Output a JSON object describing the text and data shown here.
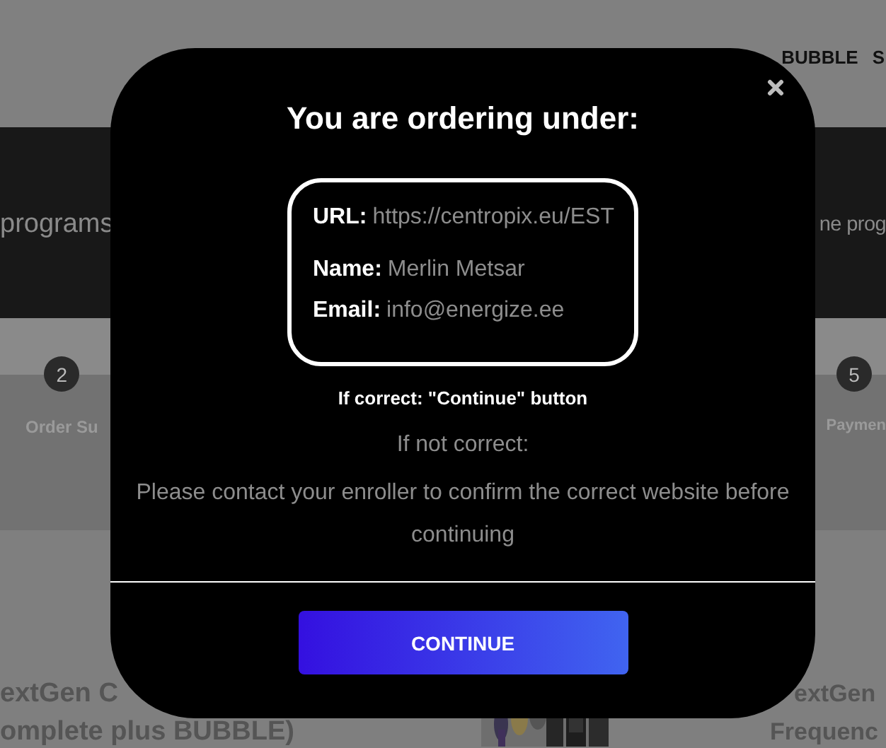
{
  "background_page": {
    "nav": [
      "BUBBLE",
      "S"
    ],
    "banner": {
      "left_text": "programs",
      "right_text": "ne prog"
    },
    "steps": [
      {
        "number": "2",
        "label": "Order Su"
      },
      {
        "number": "5",
        "label": "Paymen"
      }
    ],
    "products": [
      {
        "title_lines": [
          "extGen C",
          "omplete plus BUBBLE)"
        ]
      },
      {
        "image": {
          "kind": "picture"
        }
      },
      {
        "title_lines": [
          "extGen",
          "Frequenc"
        ]
      }
    ]
  },
  "dialog": {
    "title": "You are ordering under:",
    "fields": [
      {
        "label": "URL:",
        "value": "https://centropix.eu/EST"
      },
      {
        "label": "Name:",
        "value": "Merlin Metsar"
      },
      {
        "label": "Email:",
        "value": "info@energize.ee"
      }
    ],
    "confirm_note": "If correct: \"Continue\" button",
    "alt_heading": "If not correct:",
    "alt_message": "Please contact your enroller to confirm the correct website before continuing",
    "button": "CONTINUE"
  }
}
